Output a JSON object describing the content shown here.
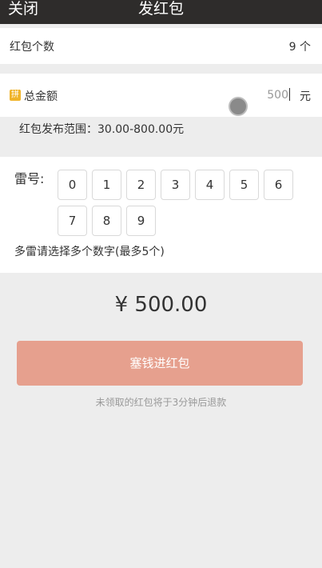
{
  "header": {
    "close_label": "关闭",
    "title": "发红包"
  },
  "count_row": {
    "label": "红包个数",
    "value": "9 个"
  },
  "amount_row": {
    "icon_text": "拼",
    "label": "总金额",
    "input_value": "500",
    "unit": "元"
  },
  "range_text": "红包发布范围：30.00-800.00元",
  "mine": {
    "label": "雷号:",
    "numbers": [
      "0",
      "1",
      "2",
      "3",
      "4",
      "5",
      "6",
      "7",
      "8",
      "9"
    ],
    "hint": "多雷请选择多个数字(最多5个)"
  },
  "total": "¥ 500.00",
  "submit_label": "塞钱进红包",
  "note": "未领取的红包将于3分钟后退款",
  "colors": {
    "header_bg": "#2e2c2b",
    "button_bg": "#e6a08e",
    "page_bg": "#ededed"
  }
}
